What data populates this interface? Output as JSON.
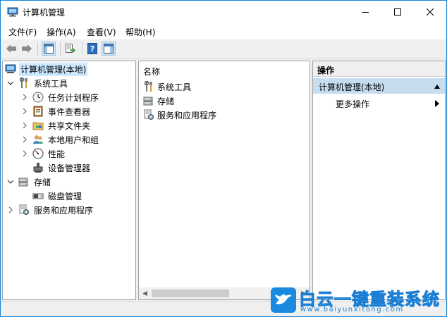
{
  "window": {
    "title": "计算机管理",
    "accent_color": "#1883d7"
  },
  "menu": [
    "文件(F)",
    "操作(A)",
    "查看(V)",
    "帮助(H)"
  ],
  "toolbar": {
    "buttons": [
      "back-arrow-icon",
      "forward-arrow-icon",
      "show-tree-icon",
      "export-list-icon",
      "help-icon",
      "show-action-pane-icon"
    ]
  },
  "tree": {
    "root": "计算机管理(本地)",
    "items": [
      {
        "label": "系统工具",
        "expanded": true
      },
      {
        "label": "任务计划程序"
      },
      {
        "label": "事件查看器"
      },
      {
        "label": "共享文件夹"
      },
      {
        "label": "本地用户和组"
      },
      {
        "label": "性能"
      },
      {
        "label": "设备管理器"
      },
      {
        "label": "存储",
        "expanded": true
      },
      {
        "label": "磁盘管理"
      },
      {
        "label": "服务和应用程序"
      }
    ]
  },
  "list": {
    "header": "名称",
    "rows": [
      "系统工具",
      "存储",
      "服务和应用程序"
    ]
  },
  "actions": {
    "header": "操作",
    "group": "计算机管理(本地)",
    "item": "更多操作"
  },
  "watermark": {
    "text": "白云一键重装系统",
    "url": "www.baiyunxitong.com"
  }
}
